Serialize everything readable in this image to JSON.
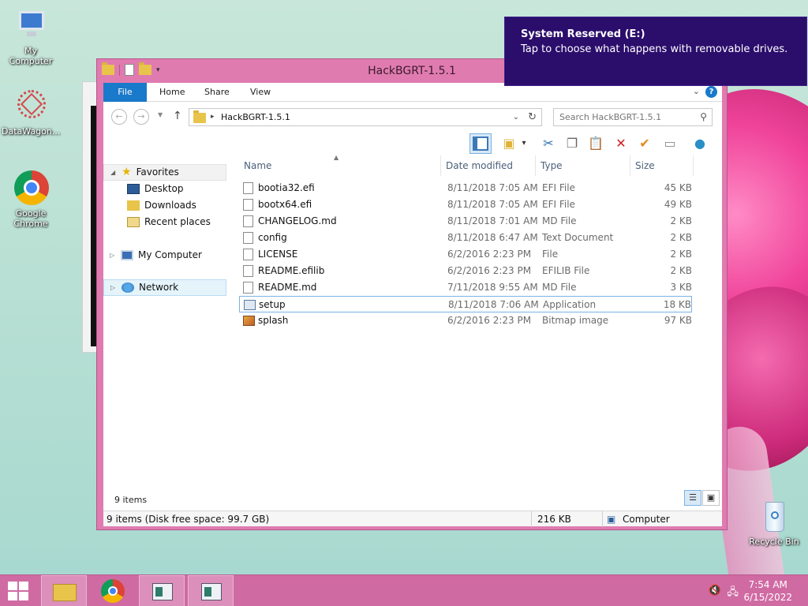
{
  "desktop": {
    "icons": [
      {
        "label": "My Computer"
      },
      {
        "label": "DataWagon..."
      },
      {
        "label": "Google Chrome"
      },
      {
        "label": "Recycle Bin"
      }
    ]
  },
  "toast": {
    "title": "System Reserved (E:)",
    "message": "Tap to choose what happens with removable drives."
  },
  "window": {
    "title": "HackBGRT-1.5.1",
    "ribbon_tabs": [
      "File",
      "Home",
      "Share",
      "View"
    ],
    "help_label": "?",
    "address_path": "HackBGRT-1.5.1",
    "search_placeholder": "Search HackBGRT-1.5.1"
  },
  "nav": {
    "favorites": "Favorites",
    "desktop": "Desktop",
    "downloads": "Downloads",
    "recent": "Recent places",
    "computer": "My Computer",
    "network": "Network"
  },
  "columns": {
    "name": "Name",
    "date": "Date modified",
    "type": "Type",
    "size": "Size"
  },
  "files": [
    {
      "name": "bootia32.efi",
      "date": "8/11/2018 7:05 AM",
      "type": "EFI File",
      "size": "45 KB",
      "icon": "file-icon"
    },
    {
      "name": "bootx64.efi",
      "date": "8/11/2018 7:05 AM",
      "type": "EFI File",
      "size": "49 KB",
      "icon": "file-icon"
    },
    {
      "name": "CHANGELOG.md",
      "date": "8/11/2018 7:01 AM",
      "type": "MD File",
      "size": "2 KB",
      "icon": "file-icon"
    },
    {
      "name": "config",
      "date": "8/11/2018 6:47 AM",
      "type": "Text Document",
      "size": "2 KB",
      "icon": "text-file-icon"
    },
    {
      "name": "LICENSE",
      "date": "6/2/2016 2:23 PM",
      "type": "File",
      "size": "2 KB",
      "icon": "file-icon"
    },
    {
      "name": "README.efilib",
      "date": "6/2/2016 2:23 PM",
      "type": "EFILIB File",
      "size": "2 KB",
      "icon": "file-icon"
    },
    {
      "name": "README.md",
      "date": "7/11/2018 9:55 AM",
      "type": "MD File",
      "size": "3 KB",
      "icon": "file-icon"
    },
    {
      "name": "setup",
      "date": "8/11/2018 7:06 AM",
      "type": "Application",
      "size": "18 KB",
      "icon": "application-icon"
    },
    {
      "name": "splash",
      "date": "6/2/2016 2:23 PM",
      "type": "Bitmap image",
      "size": "97 KB",
      "icon": "bitmap-icon"
    }
  ],
  "footer": {
    "item_count": "9 items"
  },
  "status": {
    "summary": "9 items (Disk free space: 99.7 GB)",
    "size": "216 KB",
    "location": "Computer"
  },
  "taskbar": {
    "time": "7:54 AM",
    "date": "6/15/2022"
  }
}
